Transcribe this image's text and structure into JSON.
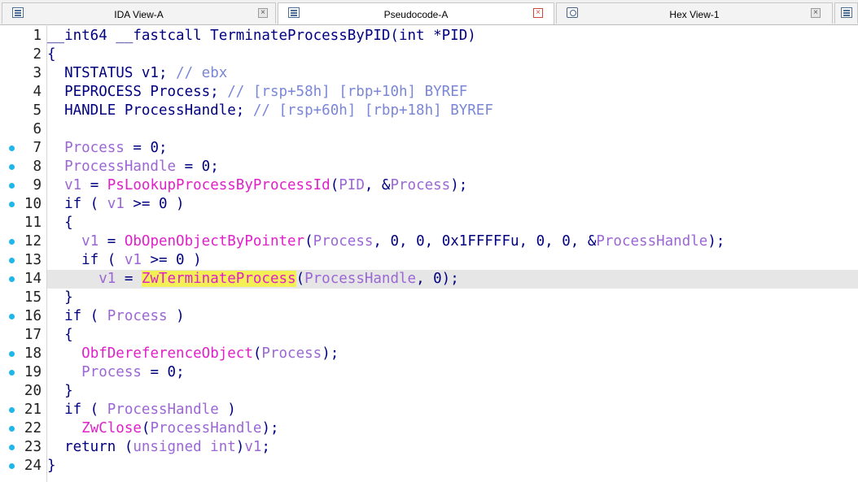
{
  "tabs": [
    {
      "label": "IDA View-A",
      "active": false,
      "icon": "listing-icon",
      "close_style": "normal"
    },
    {
      "label": "Pseudocode-A",
      "active": true,
      "icon": "listing-icon",
      "close_style": "red"
    },
    {
      "label": "Hex View-1",
      "active": false,
      "icon": "hex-view-icon",
      "close_style": "normal"
    }
  ],
  "colors": {
    "keyword": "#000080",
    "variable": "#9b67d4",
    "comment": "#7a86d6",
    "function": "#e020c8",
    "highlight": "#f3f056",
    "breakpoint_dot": "#1fb6ea",
    "current_line": "#e6e6e6"
  },
  "current_line": 14,
  "lines": [
    {
      "num": "1",
      "dot": false,
      "tokens": [
        {
          "t": "__int64 __fastcall TerminateProcessByPID(int *PID)",
          "c": "kw"
        }
      ]
    },
    {
      "num": "2",
      "dot": false,
      "tokens": [
        {
          "t": "{",
          "c": "kw"
        }
      ]
    },
    {
      "num": "3",
      "dot": false,
      "tokens": [
        {
          "t": "  NTSTATUS v1; ",
          "c": "kw"
        },
        {
          "t": "// ebx",
          "c": "cmt"
        }
      ]
    },
    {
      "num": "4",
      "dot": false,
      "tokens": [
        {
          "t": "  PEPROCESS Process; ",
          "c": "kw"
        },
        {
          "t": "// [rsp+58h] [rbp+10h] BYREF",
          "c": "cmt"
        }
      ]
    },
    {
      "num": "5",
      "dot": false,
      "tokens": [
        {
          "t": "  HANDLE ProcessHandle; ",
          "c": "kw"
        },
        {
          "t": "// [rsp+60h] [rbp+18h] BYREF",
          "c": "cmt"
        }
      ]
    },
    {
      "num": "6",
      "dot": false,
      "tokens": []
    },
    {
      "num": "7",
      "dot": true,
      "tokens": [
        {
          "t": "  ",
          "c": "kw"
        },
        {
          "t": "Process",
          "c": "var"
        },
        {
          "t": " = 0;",
          "c": "kw"
        }
      ]
    },
    {
      "num": "8",
      "dot": true,
      "tokens": [
        {
          "t": "  ",
          "c": "kw"
        },
        {
          "t": "ProcessHandle",
          "c": "var"
        },
        {
          "t": " = 0;",
          "c": "kw"
        }
      ]
    },
    {
      "num": "9",
      "dot": true,
      "tokens": [
        {
          "t": "  ",
          "c": "kw"
        },
        {
          "t": "v1",
          "c": "var"
        },
        {
          "t": " = ",
          "c": "kw"
        },
        {
          "t": "PsLookupProcessByProcessId",
          "c": "fn"
        },
        {
          "t": "(",
          "c": "kw"
        },
        {
          "t": "PID",
          "c": "var"
        },
        {
          "t": ", &",
          "c": "kw"
        },
        {
          "t": "Process",
          "c": "var"
        },
        {
          "t": ");",
          "c": "kw"
        }
      ]
    },
    {
      "num": "10",
      "dot": true,
      "tokens": [
        {
          "t": "  if ( ",
          "c": "kw"
        },
        {
          "t": "v1",
          "c": "var"
        },
        {
          "t": " >= 0 )",
          "c": "kw"
        }
      ]
    },
    {
      "num": "11",
      "dot": false,
      "tokens": [
        {
          "t": "  {",
          "c": "kw"
        }
      ]
    },
    {
      "num": "12",
      "dot": true,
      "tokens": [
        {
          "t": "    ",
          "c": "kw"
        },
        {
          "t": "v1",
          "c": "var"
        },
        {
          "t": " = ",
          "c": "kw"
        },
        {
          "t": "ObOpenObjectByPointer",
          "c": "fn"
        },
        {
          "t": "(",
          "c": "kw"
        },
        {
          "t": "Process",
          "c": "var"
        },
        {
          "t": ", 0, 0, 0x1FFFFFu, 0, 0, &",
          "c": "kw"
        },
        {
          "t": "ProcessHandle",
          "c": "var"
        },
        {
          "t": ");",
          "c": "kw"
        }
      ]
    },
    {
      "num": "13",
      "dot": true,
      "tokens": [
        {
          "t": "    if ( ",
          "c": "kw"
        },
        {
          "t": "v1",
          "c": "var"
        },
        {
          "t": " >= 0 )",
          "c": "kw"
        }
      ]
    },
    {
      "num": "14",
      "dot": true,
      "tokens": [
        {
          "t": "      ",
          "c": "kw"
        },
        {
          "t": "v1",
          "c": "var"
        },
        {
          "t": " = ",
          "c": "kw"
        },
        {
          "t": "ZwTerminateProcess",
          "c": "hl"
        },
        {
          "t": "(",
          "c": "kw"
        },
        {
          "t": "ProcessHandle",
          "c": "var"
        },
        {
          "t": ", 0);",
          "c": "kw"
        }
      ]
    },
    {
      "num": "15",
      "dot": false,
      "tokens": [
        {
          "t": "  }",
          "c": "kw"
        }
      ]
    },
    {
      "num": "16",
      "dot": true,
      "tokens": [
        {
          "t": "  if ( ",
          "c": "kw"
        },
        {
          "t": "Process",
          "c": "var"
        },
        {
          "t": " )",
          "c": "kw"
        }
      ]
    },
    {
      "num": "17",
      "dot": false,
      "tokens": [
        {
          "t": "  {",
          "c": "kw"
        }
      ]
    },
    {
      "num": "18",
      "dot": true,
      "tokens": [
        {
          "t": "    ",
          "c": "kw"
        },
        {
          "t": "ObfDereferenceObject",
          "c": "fn"
        },
        {
          "t": "(",
          "c": "kw"
        },
        {
          "t": "Process",
          "c": "var"
        },
        {
          "t": ");",
          "c": "kw"
        }
      ]
    },
    {
      "num": "19",
      "dot": true,
      "tokens": [
        {
          "t": "    ",
          "c": "kw"
        },
        {
          "t": "Process",
          "c": "var"
        },
        {
          "t": " = 0;",
          "c": "kw"
        }
      ]
    },
    {
      "num": "20",
      "dot": false,
      "tokens": [
        {
          "t": "  }",
          "c": "kw"
        }
      ]
    },
    {
      "num": "21",
      "dot": true,
      "tokens": [
        {
          "t": "  if ( ",
          "c": "kw"
        },
        {
          "t": "ProcessHandle",
          "c": "var"
        },
        {
          "t": " )",
          "c": "kw"
        }
      ]
    },
    {
      "num": "22",
      "dot": true,
      "tokens": [
        {
          "t": "    ",
          "c": "kw"
        },
        {
          "t": "ZwClose",
          "c": "fn"
        },
        {
          "t": "(",
          "c": "kw"
        },
        {
          "t": "ProcessHandle",
          "c": "var"
        },
        {
          "t": ");",
          "c": "kw"
        }
      ]
    },
    {
      "num": "23",
      "dot": true,
      "tokens": [
        {
          "t": "  return (",
          "c": "kw"
        },
        {
          "t": "unsigned int",
          "c": "var"
        },
        {
          "t": ")",
          "c": "kw"
        },
        {
          "t": "v1",
          "c": "var"
        },
        {
          "t": ";",
          "c": "kw"
        }
      ]
    },
    {
      "num": "24",
      "dot": true,
      "tokens": [
        {
          "t": "}",
          "c": "kw"
        }
      ]
    }
  ]
}
